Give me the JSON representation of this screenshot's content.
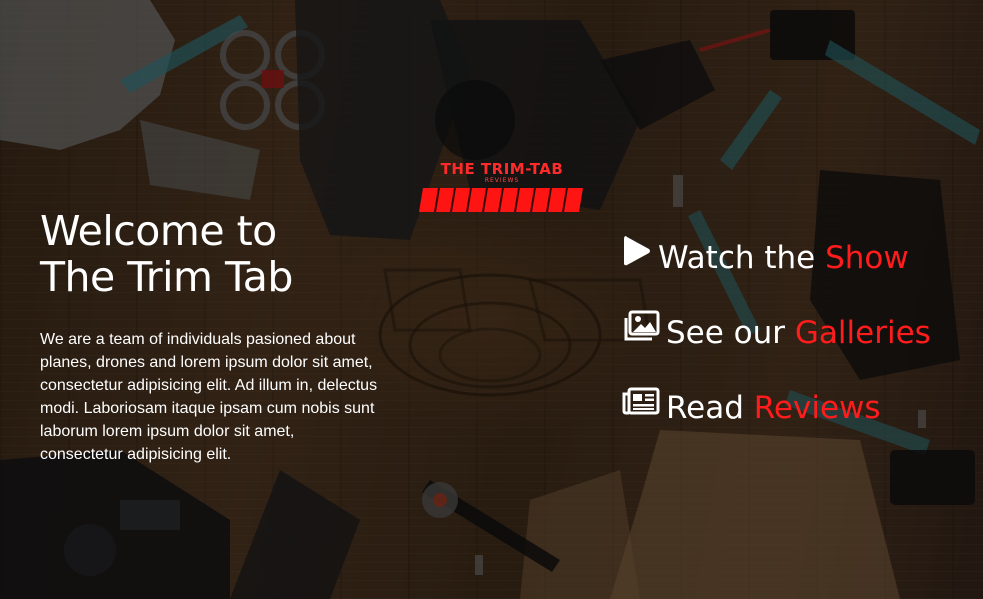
{
  "brand": {
    "logo_title": "THE TRIM-TAB",
    "logo_subtitle": "REVIEWS"
  },
  "hero": {
    "heading_line1": "Welcome to",
    "heading_line2": "The Trim Tab",
    "intro_text": "We are a team of individuals pasioned about planes, drones and lorem ipsum dolor sit amet, consectetur adipisicing elit. Ad illum in, delectus modi. Laboriosam itaque ipsam cum nobis sunt laborum lorem ipsum dolor sit amet, consectetur adipisicing elit."
  },
  "links": [
    {
      "icon": "play-icon",
      "prefix": "Watch the",
      "accent": "Show"
    },
    {
      "icon": "image-gallery-icon",
      "prefix": "See our",
      "accent": "Galleries"
    },
    {
      "icon": "newspaper-icon",
      "prefix": "Read",
      "accent": "Reviews"
    }
  ],
  "colors": {
    "accent": "#ff1c1c",
    "text": "#ffffff",
    "wood": "#4b3420"
  }
}
